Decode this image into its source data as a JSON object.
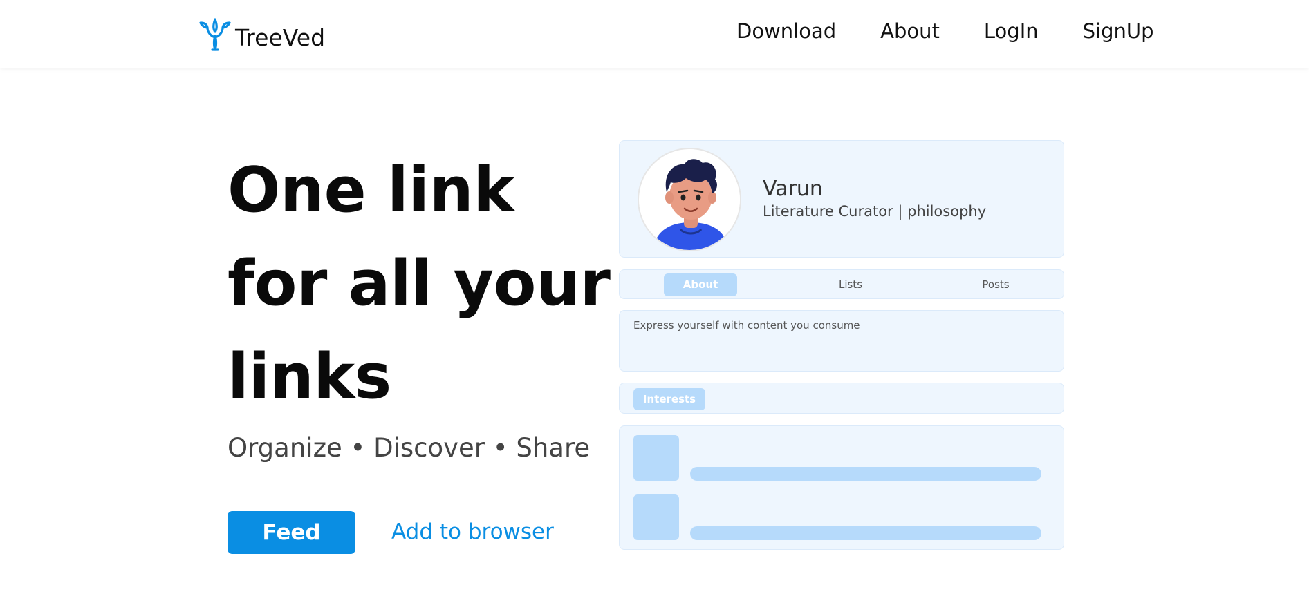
{
  "nav": {
    "brand": "TreeVed",
    "links": [
      "Download",
      "About",
      "LogIn",
      "SignUp"
    ]
  },
  "hero": {
    "title": "One link for all your links",
    "subtitle": "Organize • Discover • Share",
    "primary_button": "Feed",
    "secondary_link": "Add to browser"
  },
  "preview": {
    "name": "Varun",
    "role": "Literature Curator | philosophy",
    "tabs": [
      "About",
      "Lists",
      "Posts"
    ],
    "active_tab": "About",
    "bio": "Express yourself with content you consume",
    "interests_label": "Interests"
  },
  "colors": {
    "accent": "#0a8ee3",
    "preview_bg": "#eef6fe",
    "preview_block": "#b6dafb"
  },
  "icons": {
    "logo": "tree-logo-icon",
    "avatar": "avatar-illustration"
  }
}
